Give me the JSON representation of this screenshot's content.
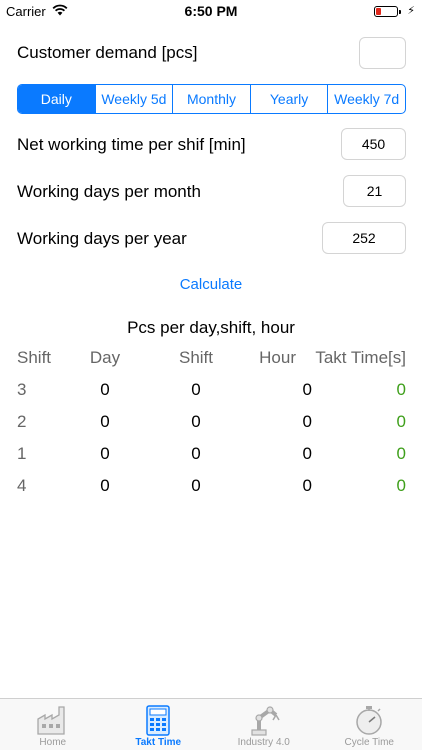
{
  "status": {
    "carrier": "Carrier",
    "time": "6:50 PM"
  },
  "form": {
    "customer_demand_label": "Customer demand [pcs]",
    "customer_demand_value": "",
    "periods": [
      "Daily",
      "Weekly 5d",
      "Monthly",
      "Yearly",
      "Weekly 7d"
    ],
    "selected_period": "Daily",
    "net_time_label": "Net working time per shif [min]",
    "net_time_value": "450",
    "days_month_label": "Working days per month",
    "days_month_value": "21",
    "days_year_label": "Working days per year",
    "days_year_value": "252",
    "calculate_label": "Calculate"
  },
  "results": {
    "title": "Pcs per day,shift, hour",
    "headers": [
      "Shift",
      "Day",
      "Shift",
      "Hour",
      "Takt Time[s]"
    ],
    "rows": [
      [
        "3",
        "0",
        "0",
        "0",
        "0"
      ],
      [
        "2",
        "0",
        "0",
        "0",
        "0"
      ],
      [
        "1",
        "0",
        "0",
        "0",
        "0"
      ],
      [
        "4",
        "0",
        "0",
        "0",
        "0"
      ]
    ]
  },
  "tabs": [
    {
      "label": "Home",
      "icon": "factory-icon",
      "active": false
    },
    {
      "label": "Takt Time",
      "icon": "calculator-icon",
      "active": true
    },
    {
      "label": "Industry 4.0",
      "icon": "robot-arm-icon",
      "active": false
    },
    {
      "label": "Cycle Time",
      "icon": "stopwatch-icon",
      "active": false
    }
  ],
  "colors": {
    "accent": "#0a7aff",
    "takt_value": "#3e9f1a",
    "battery_low": "#e0281c"
  }
}
